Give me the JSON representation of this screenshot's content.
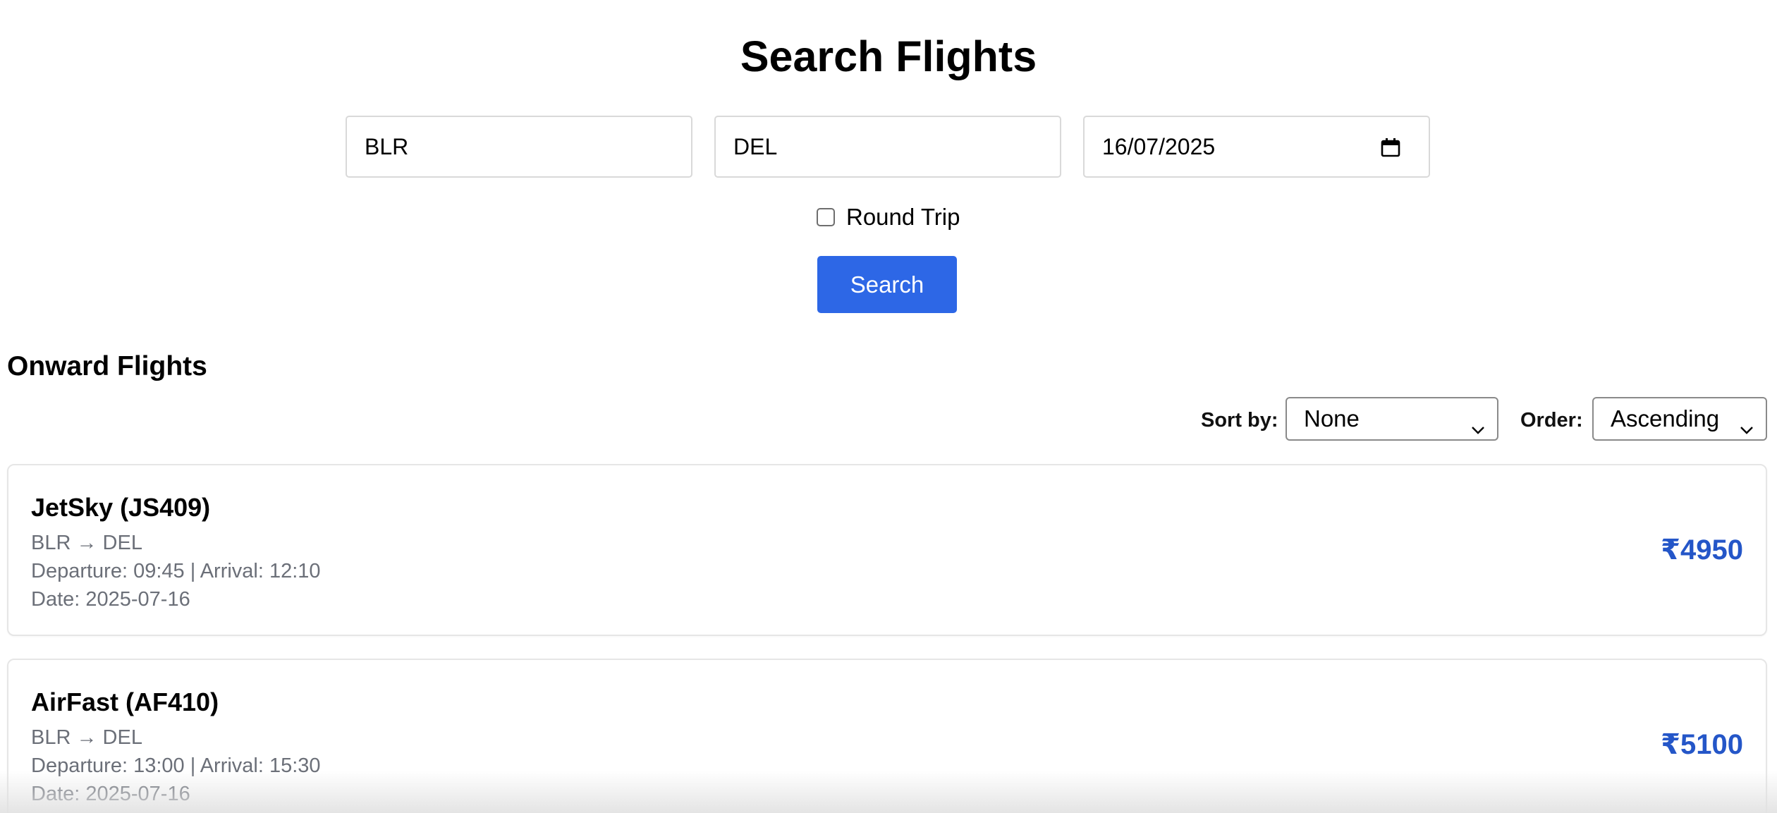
{
  "page": {
    "title": "Search Flights"
  },
  "search": {
    "from_value": "BLR",
    "to_value": "DEL",
    "date_value": "16/07/2025",
    "round_trip_label": "Round Trip",
    "round_trip_checked": false,
    "search_label": "Search"
  },
  "results": {
    "section_title": "Onward Flights",
    "sort_by_label": "Sort by:",
    "sort_by_value": "None",
    "order_label": "Order:",
    "order_value": "Ascending",
    "flights": [
      {
        "name": "JetSky (JS409)",
        "route": "BLR → DEL",
        "times": "Departure: 09:45 | Arrival: 12:10",
        "date": "Date: 2025-07-16",
        "price": "₹4950"
      },
      {
        "name": "AirFast (AF410)",
        "route": "BLR → DEL",
        "times": "Departure: 13:00 | Arrival: 15:30",
        "date": "Date: 2025-07-16",
        "price": "₹5100"
      }
    ]
  },
  "colors": {
    "accent": "#2d67e6",
    "price": "#2456c8",
    "muted_text": "#6b6f78",
    "border": "#e6e6e6"
  },
  "icons": {
    "date_picker": "calendar-icon",
    "select_arrow": "chevron-down-icon"
  }
}
